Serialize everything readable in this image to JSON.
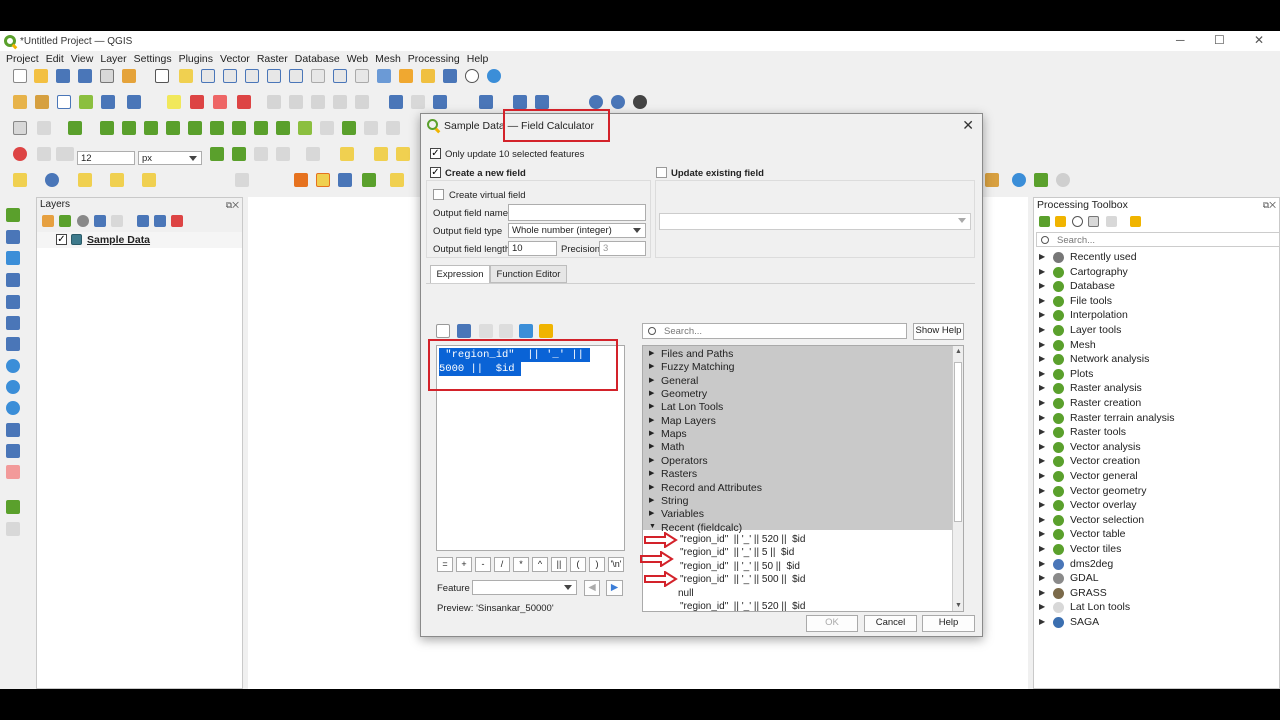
{
  "window": {
    "title": "*Untitled Project — QGIS",
    "minimize": "─",
    "maximize": "☐",
    "close": "✕"
  },
  "menu": [
    "Project",
    "Edit",
    "View",
    "Layer",
    "Settings",
    "Plugins",
    "Vector",
    "Raster",
    "Database",
    "Web",
    "Mesh",
    "Processing",
    "Help"
  ],
  "toolbar": {
    "font_size": "12",
    "unit": "px"
  },
  "layers": {
    "title": "Layers",
    "items": [
      {
        "name": "Sample Data",
        "checked": "✓"
      }
    ]
  },
  "processing": {
    "title": "Processing Toolbox",
    "search_placeholder": "Search...",
    "items": [
      "Recently used",
      "Cartography",
      "Database",
      "File tools",
      "Interpolation",
      "Layer tools",
      "Mesh",
      "Network analysis",
      "Plots",
      "Raster analysis",
      "Raster creation",
      "Raster terrain analysis",
      "Raster tools",
      "Vector analysis",
      "Vector creation",
      "Vector general",
      "Vector geometry",
      "Vector overlay",
      "Vector selection",
      "Vector table",
      "Vector tiles",
      "dms2deg",
      "GDAL",
      "GRASS",
      "Lat Lon tools",
      "SAGA"
    ]
  },
  "dialog": {
    "title": "Sample Data — Field Calculator",
    "close": "✕",
    "only_update": "Only update 10 selected features",
    "create_new_field": "Create a new field",
    "update_existing": "Update existing field",
    "create_virtual": "Create virtual field",
    "output_name_label": "Output field name",
    "output_type_label": "Output field type",
    "output_type_value": "Whole number (integer)",
    "output_length_label": "Output field length",
    "output_length_value": "10",
    "precision_label": "Precision",
    "precision_value": "3",
    "tabs": [
      "Expression",
      "Function Editor"
    ],
    "expression_line1": " \"region_id\"  || '_' || ",
    "expression_line2": "5000 ||  $id ",
    "operators": [
      "=",
      "+",
      "-",
      "/",
      "*",
      "^",
      "||",
      "(",
      ")",
      "'\\n'"
    ],
    "feature_label": "Feature",
    "preview_label": "Preview:",
    "preview_value": "'Sinsankar_50000'",
    "search_placeholder": "Search...",
    "show_help": "Show Help",
    "groups": [
      "Files and Paths",
      "Fuzzy Matching",
      "General",
      "Geometry",
      "Lat Lon Tools",
      "Map Layers",
      "Maps",
      "Math",
      "Operators",
      "Rasters",
      "Record and Attributes",
      "String",
      "Variables",
      "Recent (fieldcalc)"
    ],
    "recent": [
      "\"region_id\"  || '_' || 520 ||  $id",
      "\"region_id\"  || '_' || 5 ||  $id",
      "\"region_id\"  || '_' || 50 ||  $id",
      "\"region_id\"  || '_' || 500 ||  $id",
      "null",
      "\"region_id\"  || '_' || 520 ||  $id"
    ],
    "ok": "OK",
    "cancel": "Cancel",
    "help": "Help"
  },
  "colors": {
    "selection": "#0a63d6",
    "highlight_red": "#d3222a",
    "qgis_green": "#5aa02c"
  }
}
